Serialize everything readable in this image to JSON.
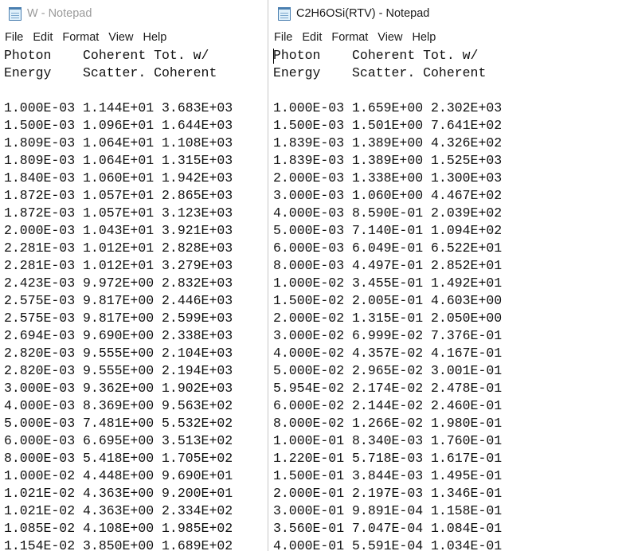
{
  "left_window": {
    "title": "W - Notepad",
    "menu": [
      "File",
      "Edit",
      "Format",
      "View",
      "Help"
    ],
    "lines": [
      "Photon    Coherent Tot. w/",
      "Energy    Scatter. Coherent",
      "",
      "1.000E-03 1.144E+01 3.683E+03",
      "1.500E-03 1.096E+01 1.644E+03",
      "1.809E-03 1.064E+01 1.108E+03",
      "1.809E-03 1.064E+01 1.315E+03",
      "1.840E-03 1.060E+01 1.942E+03",
      "1.872E-03 1.057E+01 2.865E+03",
      "1.872E-03 1.057E+01 3.123E+03",
      "2.000E-03 1.043E+01 3.921E+03",
      "2.281E-03 1.012E+01 2.828E+03",
      "2.281E-03 1.012E+01 3.279E+03",
      "2.423E-03 9.972E+00 2.832E+03",
      "2.575E-03 9.817E+00 2.446E+03",
      "2.575E-03 9.817E+00 2.599E+03",
      "2.694E-03 9.690E+00 2.338E+03",
      "2.820E-03 9.555E+00 2.104E+03",
      "2.820E-03 9.555E+00 2.194E+03",
      "3.000E-03 9.362E+00 1.902E+03",
      "4.000E-03 8.369E+00 9.563E+02",
      "5.000E-03 7.481E+00 5.532E+02",
      "6.000E-03 6.695E+00 3.513E+02",
      "8.000E-03 5.418E+00 1.705E+02",
      "1.000E-02 4.448E+00 9.690E+01",
      "1.021E-02 4.363E+00 9.200E+01",
      "1.021E-02 4.363E+00 2.334E+02",
      "1.085E-02 4.108E+00 1.985E+02",
      "1.154E-02 3.850E+00 1.689E+02"
    ]
  },
  "right_window": {
    "title": "C2H6OSi(RTV) - Notepad",
    "menu": [
      "File",
      "Edit",
      "Format",
      "View",
      "Help"
    ],
    "lines": [
      "Photon    Coherent Tot. w/",
      "Energy    Scatter. Coherent",
      "",
      "1.000E-03 1.659E+00 2.302E+03",
      "1.500E-03 1.501E+00 7.641E+02",
      "1.839E-03 1.389E+00 4.326E+02",
      "1.839E-03 1.389E+00 1.525E+03",
      "2.000E-03 1.338E+00 1.300E+03",
      "3.000E-03 1.060E+00 4.467E+02",
      "4.000E-03 8.590E-01 2.039E+02",
      "5.000E-03 7.140E-01 1.094E+02",
      "6.000E-03 6.049E-01 6.522E+01",
      "8.000E-03 4.497E-01 2.852E+01",
      "1.000E-02 3.455E-01 1.492E+01",
      "1.500E-02 2.005E-01 4.603E+00",
      "2.000E-02 1.315E-01 2.050E+00",
      "3.000E-02 6.999E-02 7.376E-01",
      "4.000E-02 4.357E-02 4.167E-01",
      "5.000E-02 2.965E-02 3.001E-01",
      "5.954E-02 2.174E-02 2.478E-01",
      "6.000E-02 2.144E-02 2.460E-01",
      "8.000E-02 1.266E-02 1.980E-01",
      "1.000E-01 8.340E-03 1.760E-01",
      "1.220E-01 5.718E-03 1.617E-01",
      "1.500E-01 3.844E-03 1.495E-01",
      "2.000E-01 2.197E-03 1.346E-01",
      "3.000E-01 9.891E-04 1.158E-01",
      "3.560E-01 7.047E-04 1.084E-01",
      "4.000E-01 5.591E-04 1.034E-01"
    ]
  }
}
